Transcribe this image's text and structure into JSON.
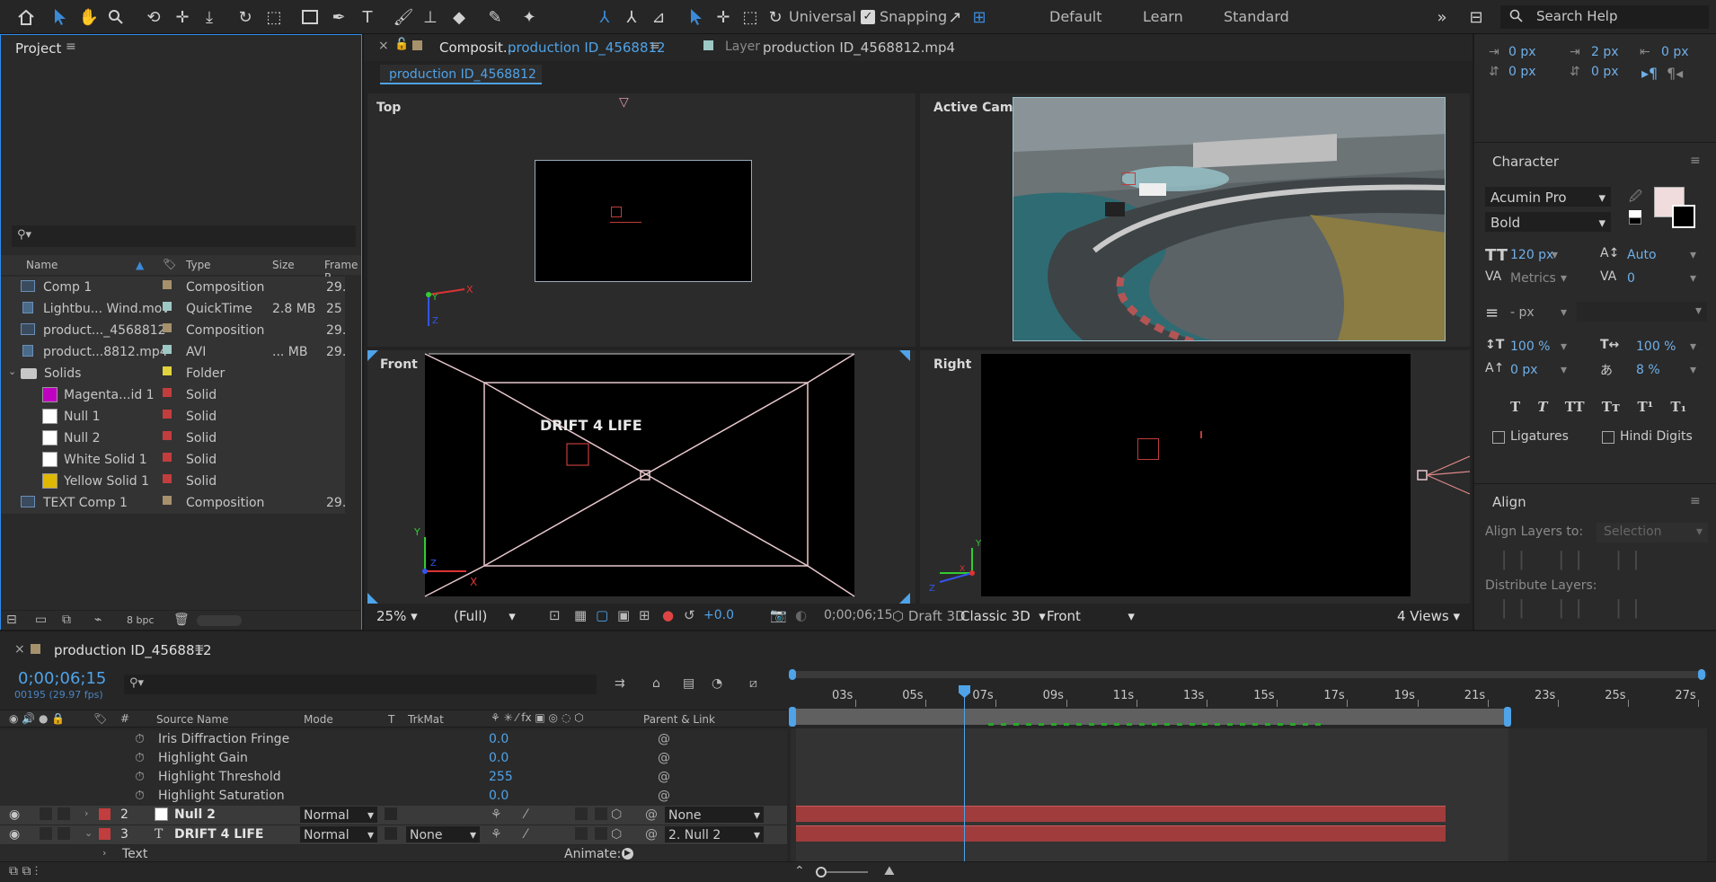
{
  "toolbar": {
    "universal": "Universal",
    "snapping": "Snapping",
    "workspaces": [
      "Default",
      "Learn",
      "Standard"
    ],
    "search_placeholder": "Search Help"
  },
  "project": {
    "title": "Project",
    "columns": [
      "Name",
      "Type",
      "Size",
      "Frame R"
    ],
    "rows": [
      {
        "name": "Comp 1",
        "type": "Composition",
        "size": "",
        "fr": "29.",
        "color": "#a5916c",
        "indent": 0,
        "kind": "comp"
      },
      {
        "name": "Lightbu... Wind.mov",
        "type": "QuickTime",
        "size": "2.8 MB",
        "fr": "25",
        "color": "#9dc8c4",
        "indent": 0,
        "kind": "file"
      },
      {
        "name": "product..._4568812",
        "type": "Composition",
        "size": "",
        "fr": "29.",
        "color": "#a5916c",
        "indent": 0,
        "kind": "comp"
      },
      {
        "name": "product...8812.mp4",
        "type": "AVI",
        "size": "... MB",
        "fr": "29.",
        "color": "#9dc8c4",
        "indent": 0,
        "kind": "file"
      },
      {
        "name": "Solids",
        "type": "Folder",
        "size": "",
        "fr": "",
        "color": "#e0d33c",
        "indent": 0,
        "kind": "folder"
      },
      {
        "name": "Magenta...id 1",
        "type": "Solid",
        "size": "",
        "fr": "",
        "color": "#c23d3d",
        "indent": 1,
        "swatch": "#c000c0"
      },
      {
        "name": "Null 1",
        "type": "Solid",
        "size": "",
        "fr": "",
        "color": "#c23d3d",
        "indent": 1,
        "swatch": "#ffffff"
      },
      {
        "name": "Null 2",
        "type": "Solid",
        "size": "",
        "fr": "",
        "color": "#c23d3d",
        "indent": 1,
        "swatch": "#ffffff"
      },
      {
        "name": "White Solid 1",
        "type": "Solid",
        "size": "",
        "fr": "",
        "color": "#c23d3d",
        "indent": 1,
        "swatch": "#ffffff"
      },
      {
        "name": "Yellow Solid 1",
        "type": "Solid",
        "size": "",
        "fr": "",
        "color": "#c23d3d",
        "indent": 1,
        "swatch": "#e0b800"
      },
      {
        "name": "TEXT Comp 1",
        "type": "Composition",
        "size": "",
        "fr": "29.",
        "color": "#a5916c",
        "indent": 0,
        "kind": "comp"
      }
    ],
    "bpc": "8 bpc"
  },
  "comp": {
    "tab1_prefix": "Composit...",
    "tab1_name": "production ID_4568812",
    "tab2_prefix": "Layer",
    "tab2_name": "production ID_4568812.mp4",
    "breadcrumb": "production ID_4568812",
    "views": {
      "top": "Top",
      "active": "Active Camera",
      "front": "Front",
      "right": "Right"
    },
    "overlay_text": "DRIFT 4 LIFE",
    "footer": {
      "zoom": "25%",
      "resolution": "(Full)",
      "exposure": "+0.0",
      "timecode": "0;00;06;15",
      "renderer_label": "Draft 3D",
      "renderer": "Classic 3D",
      "view": "Front",
      "layout": "4 Views"
    }
  },
  "paragraph": {
    "v1": "0 px",
    "v2": "2 px",
    "v3": "0 px",
    "v4": "0 px",
    "v5": "0 px"
  },
  "character": {
    "title": "Character",
    "font": "Acumin Pro",
    "style": "Bold",
    "size": "120 px",
    "leading": "Auto",
    "kerning": "Metrics",
    "tracking": "0",
    "stroke": "- px",
    "vscale": "100 %",
    "hscale": "100 %",
    "baseline": "0 px",
    "tsume": "8 %",
    "ligatures": "Ligatures",
    "hindi": "Hindi Digits"
  },
  "align": {
    "title": "Align",
    "align_to_label": "Align Layers to:",
    "align_to": "Selection",
    "distribute": "Distribute Layers:"
  },
  "timeline": {
    "comp_name": "production ID_4568812",
    "timecode": "0;00;06;15",
    "frames": "00195 (29.97 fps)",
    "headers": {
      "source": "Source Name",
      "mode": "Mode",
      "t": "T",
      "trkmat": "TrkMat",
      "parent": "Parent & Link"
    },
    "ticks": [
      "03s",
      "05s",
      "07s",
      "09s",
      "11s",
      "13s",
      "15s",
      "17s",
      "19s",
      "21s",
      "23s",
      "25s",
      "27s"
    ],
    "props": [
      {
        "name": "Iris Diffraction Fringe",
        "value": "0.0"
      },
      {
        "name": "Highlight Gain",
        "value": "0.0"
      },
      {
        "name": "Highlight Threshold",
        "value": "255"
      },
      {
        "name": "Highlight Saturation",
        "value": "0.0"
      }
    ],
    "layers": [
      {
        "num": "2",
        "name": "Null 2",
        "mode": "Normal",
        "trkmat": "",
        "parent": "None"
      },
      {
        "num": "3",
        "name": "DRIFT 4 LIFE",
        "mode": "Normal",
        "trkmat": "None",
        "parent": "2. Null 2"
      }
    ],
    "text_label": "Text",
    "animate": "Animate:"
  }
}
